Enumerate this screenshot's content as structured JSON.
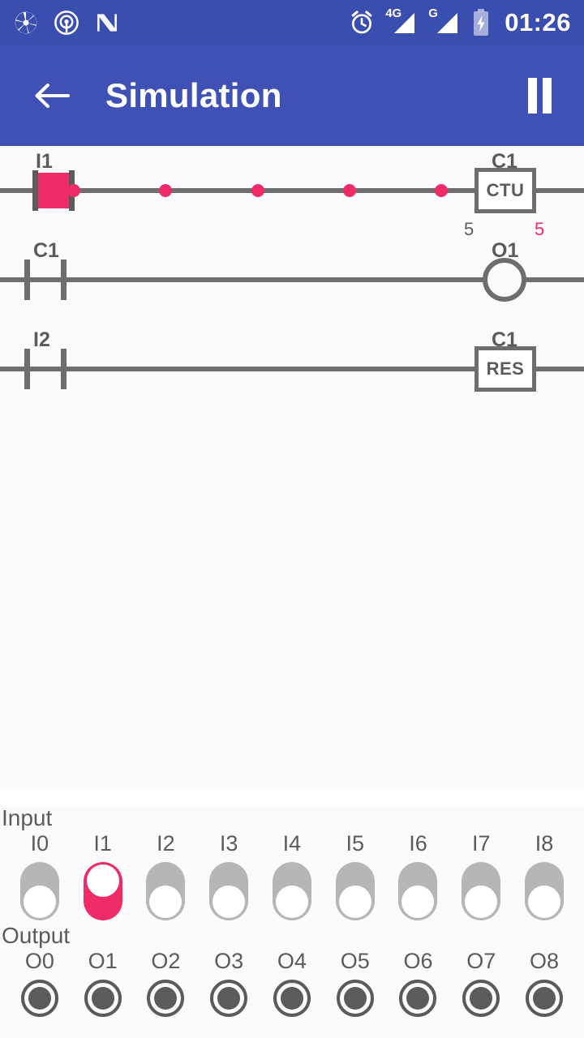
{
  "theme": {
    "statusbar_bg": "#3a4eb0",
    "appbar_bg": "#3f51b5",
    "accent": "#ef2c68",
    "wire": "#6e6e6e",
    "text": "#5b5b5b",
    "page_bg": "#fbfbfb"
  },
  "statusbar": {
    "time": "01:26",
    "left_icons": [
      "camera-shutter-icon",
      "hotspot-icon",
      "nova-launcher-icon"
    ],
    "right_icons": [
      "alarm-icon",
      "signal-4g-icon",
      "signal-g-icon",
      "battery-charging-icon"
    ],
    "signal_1_label": "4G",
    "signal_2_label": "G"
  },
  "appbar": {
    "back_label": "Back",
    "title": "Simulation",
    "pause_label": "Pause"
  },
  "ladder": {
    "rungs": [
      {
        "id": "rung-1",
        "contact": {
          "name": "I1",
          "type": "NO",
          "active": true
        },
        "dots": [
          90,
          203,
          317,
          430,
          543
        ],
        "element": {
          "kind": "block",
          "name": "C1",
          "text": "CTU"
        },
        "params": [
          {
            "value": "5",
            "accent": false
          },
          {
            "value": "5",
            "accent": true
          }
        ]
      },
      {
        "id": "rung-2",
        "contact": {
          "name": "C1",
          "type": "NO",
          "active": false
        },
        "dots": [],
        "element": {
          "kind": "coil",
          "name": "O1",
          "text": ""
        },
        "params": []
      },
      {
        "id": "rung-3",
        "contact": {
          "name": "I2",
          "type": "NO",
          "active": false
        },
        "dots": [],
        "element": {
          "kind": "block",
          "name": "C1",
          "text": "RES"
        },
        "params": []
      }
    ]
  },
  "io": {
    "input_label": "Input",
    "output_label": "Output",
    "inputs": [
      {
        "name": "I0",
        "on": false
      },
      {
        "name": "I1",
        "on": true
      },
      {
        "name": "I2",
        "on": false
      },
      {
        "name": "I3",
        "on": false
      },
      {
        "name": "I4",
        "on": false
      },
      {
        "name": "I5",
        "on": false
      },
      {
        "name": "I6",
        "on": false
      },
      {
        "name": "I7",
        "on": false
      },
      {
        "name": "I8",
        "on": false
      }
    ],
    "outputs": [
      {
        "name": "O0",
        "on": false
      },
      {
        "name": "O1",
        "on": false
      },
      {
        "name": "O2",
        "on": false
      },
      {
        "name": "O3",
        "on": false
      },
      {
        "name": "O4",
        "on": false
      },
      {
        "name": "O5",
        "on": false
      },
      {
        "name": "O6",
        "on": false
      },
      {
        "name": "O7",
        "on": false
      },
      {
        "name": "O8",
        "on": false
      }
    ]
  }
}
